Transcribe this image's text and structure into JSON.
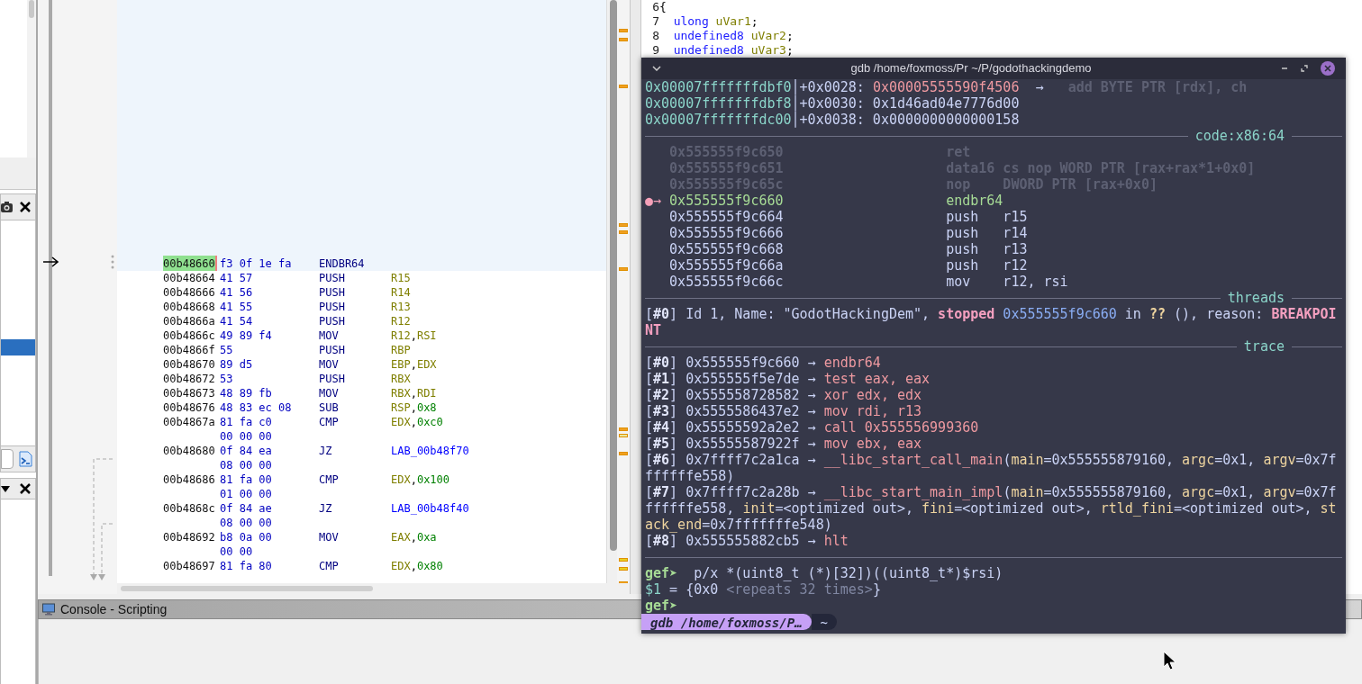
{
  "listing": {
    "rows": [
      {
        "address": "00b48660",
        "bytes": "f3 0f 1e fa",
        "mnemonic": "ENDBR64",
        "operands": [],
        "selected": true
      },
      {
        "address": "00b48664",
        "bytes": "41 57",
        "mnemonic": "PUSH",
        "operands": [
          {
            "text": "R15",
            "kind": "reg"
          }
        ],
        "selected": false
      },
      {
        "address": "00b48666",
        "bytes": "41 56",
        "mnemonic": "PUSH",
        "operands": [
          {
            "text": "R14",
            "kind": "reg"
          }
        ],
        "selected": false
      },
      {
        "address": "00b48668",
        "bytes": "41 55",
        "mnemonic": "PUSH",
        "operands": [
          {
            "text": "R13",
            "kind": "reg"
          }
        ],
        "selected": false
      },
      {
        "address": "00b4866a",
        "bytes": "41 54",
        "mnemonic": "PUSH",
        "operands": [
          {
            "text": "R12",
            "kind": "reg"
          }
        ],
        "selected": false
      },
      {
        "address": "00b4866c",
        "bytes": "49 89 f4",
        "mnemonic": "MOV",
        "operands": [
          {
            "text": "R12",
            "kind": "reg"
          },
          {
            "text": ",",
            "kind": "punct"
          },
          {
            "text": "RSI",
            "kind": "reg"
          }
        ],
        "selected": false
      },
      {
        "address": "00b4866f",
        "bytes": "55",
        "mnemonic": "PUSH",
        "operands": [
          {
            "text": "RBP",
            "kind": "reg"
          }
        ],
        "selected": false
      },
      {
        "address": "00b48670",
        "bytes": "89 d5",
        "mnemonic": "MOV",
        "operands": [
          {
            "text": "EBP",
            "kind": "reg"
          },
          {
            "text": ",",
            "kind": "punct"
          },
          {
            "text": "EDX",
            "kind": "reg"
          }
        ],
        "selected": false
      },
      {
        "address": "00b48672",
        "bytes": "53",
        "mnemonic": "PUSH",
        "operands": [
          {
            "text": "RBX",
            "kind": "reg"
          }
        ],
        "selected": false
      },
      {
        "address": "00b48673",
        "bytes": "48 89 fb",
        "mnemonic": "MOV",
        "operands": [
          {
            "text": "RBX",
            "kind": "reg"
          },
          {
            "text": ",",
            "kind": "punct"
          },
          {
            "text": "RDI",
            "kind": "reg"
          }
        ],
        "selected": false
      },
      {
        "address": "00b48676",
        "bytes": "48 83 ec 08",
        "mnemonic": "SUB",
        "operands": [
          {
            "text": "RSP",
            "kind": "reg"
          },
          {
            "text": ",",
            "kind": "punct"
          },
          {
            "text": "0x8",
            "kind": "num"
          }
        ],
        "selected": false
      },
      {
        "address": "00b4867a",
        "bytes": "81 fa c0",
        "bytes_more": "00 00 00",
        "mnemonic": "CMP",
        "operands": [
          {
            "text": "EDX",
            "kind": "reg"
          },
          {
            "text": ",",
            "kind": "punct"
          },
          {
            "text": "0xc0",
            "kind": "num"
          }
        ],
        "selected": false
      },
      {
        "address": "00b48680",
        "bytes": "0f 84 ea",
        "bytes_more": "08 00 00",
        "mnemonic": "JZ",
        "operands": [
          {
            "text": "LAB_00b48f70",
            "kind": "label"
          }
        ],
        "selected": false
      },
      {
        "address": "00b48686",
        "bytes": "81 fa 00",
        "bytes_more": "01 00 00",
        "mnemonic": "CMP",
        "operands": [
          {
            "text": "EDX",
            "kind": "reg"
          },
          {
            "text": ",",
            "kind": "punct"
          },
          {
            "text": "0x100",
            "kind": "num"
          }
        ],
        "selected": false
      },
      {
        "address": "00b4868c",
        "bytes": "0f 84 ae",
        "bytes_more": "08 00 00",
        "mnemonic": "JZ",
        "operands": [
          {
            "text": "LAB_00b48f40",
            "kind": "label"
          }
        ],
        "selected": false
      },
      {
        "address": "00b48692",
        "bytes": "b8 0a 00",
        "bytes_more": "00 00",
        "mnemonic": "MOV",
        "operands": [
          {
            "text": "EAX",
            "kind": "reg"
          },
          {
            "text": ",",
            "kind": "punct"
          },
          {
            "text": "0xa",
            "kind": "num"
          }
        ],
        "selected": false
      },
      {
        "address": "00b48697",
        "bytes": "81 fa 80",
        "mnemonic": "CMP",
        "operands": [
          {
            "text": "EDX",
            "kind": "reg"
          },
          {
            "text": ",",
            "kind": "punct"
          },
          {
            "text": "0x80",
            "kind": "num"
          }
        ],
        "selected": false
      }
    ]
  },
  "decompiler": {
    "lines": [
      {
        "number": "6",
        "segments": [
          {
            "text": "{",
            "kind": "punct"
          }
        ]
      },
      {
        "number": "7",
        "segments": [
          {
            "text": "ulong",
            "kind": "type"
          },
          {
            "text": "uVar1",
            "kind": "var"
          },
          {
            "text": ";",
            "kind": "punct"
          }
        ]
      },
      {
        "number": "8",
        "segments": [
          {
            "text": "undefined8",
            "kind": "type"
          },
          {
            "text": "uVar2",
            "kind": "var"
          },
          {
            "text": ";",
            "kind": "punct"
          }
        ]
      },
      {
        "number": "9",
        "segments": [
          {
            "text": "undefined8",
            "kind": "type"
          },
          {
            "text": "uVar3",
            "kind": "var"
          },
          {
            "text": ";",
            "kind": "punct"
          }
        ]
      }
    ]
  },
  "console": {
    "title": "Console - Scripting"
  },
  "terminal": {
    "title": "gdb /home/foxmoss/Pr ~/P/godothackingdemo",
    "lines": [
      {
        "kind": "text",
        "segments": [
          {
            "text": "0x00007fffffffdbf0",
            "kind": "addr"
          },
          {
            "text": "│+0x0028: ",
            "kind": "plain"
          },
          {
            "text": "0x00005555590f4506",
            "kind": "pink"
          },
          {
            "text": "  →   ",
            "kind": "plain"
          },
          {
            "text": "add BYTE PTR [rdx], ch",
            "kind": "dim"
          }
        ]
      },
      {
        "kind": "text",
        "segments": [
          {
            "text": "0x00007fffffffdbf8",
            "kind": "addr"
          },
          {
            "text": "│+0x0030: 0x1d46ad04e7776d00",
            "kind": "plain"
          }
        ]
      },
      {
        "kind": "text",
        "segments": [
          {
            "text": "0x00007fffffffdc00",
            "kind": "addr"
          },
          {
            "text": "│+0x0038: 0x0000000000000158",
            "kind": "plain"
          }
        ]
      },
      {
        "kind": "rule",
        "title": "code:x86:64"
      },
      {
        "kind": "text",
        "segments": [
          {
            "text": "   0x555555f9c650                    ret",
            "kind": "dim"
          }
        ]
      },
      {
        "kind": "text",
        "segments": [
          {
            "text": "   0x555555f9c651                    data16 cs nop WORD PTR [rax+rax*1+0x0]",
            "kind": "dim"
          }
        ]
      },
      {
        "kind": "text",
        "segments": [
          {
            "text": "   0x555555f9c65c                    nop    DWORD PTR [rax+0x0]",
            "kind": "dim"
          }
        ]
      },
      {
        "kind": "text",
        "segments": [
          {
            "text": "●→ ",
            "kind": "marker"
          },
          {
            "text": "0x555555f9c660                    endbr64",
            "kind": "green"
          }
        ]
      },
      {
        "kind": "text",
        "segments": [
          {
            "text": "   0x555555f9c664                    push   r15",
            "kind": "plain"
          }
        ]
      },
      {
        "kind": "text",
        "segments": [
          {
            "text": "   0x555555f9c666                    push   r14",
            "kind": "plain"
          }
        ]
      },
      {
        "kind": "text",
        "segments": [
          {
            "text": "   0x555555f9c668                    push   r13",
            "kind": "plain"
          }
        ]
      },
      {
        "kind": "text",
        "segments": [
          {
            "text": "   0x555555f9c66a                    push   r12",
            "kind": "plain"
          }
        ]
      },
      {
        "kind": "text",
        "segments": [
          {
            "text": "   0x555555f9c66c                    mov    r12, rsi",
            "kind": "plain"
          }
        ]
      },
      {
        "kind": "rule",
        "title": "threads"
      },
      {
        "kind": "text",
        "segments": [
          {
            "text": "[",
            "kind": "plain"
          },
          {
            "text": "#0",
            "kind": "bold"
          },
          {
            "text": "] Id 1, Name: \"GodotHackingDem\", ",
            "kind": "plain"
          },
          {
            "text": "stopped",
            "kind": "alert"
          },
          {
            "text": " 0x555555f9c660",
            "kind": "blue"
          },
          {
            "text": " in ",
            "kind": "plain"
          },
          {
            "text": "??",
            "kind": "yellowbold"
          },
          {
            "text": " (), reason: ",
            "kind": "plain"
          },
          {
            "text": "BREAKPOINT",
            "kind": "alert"
          }
        ]
      },
      {
        "kind": "rule",
        "title": "trace"
      },
      {
        "kind": "text",
        "segments": [
          {
            "text": "[",
            "kind": "plain"
          },
          {
            "text": "#0",
            "kind": "bold"
          },
          {
            "text": "] 0x555555f9c660 → ",
            "kind": "plain"
          },
          {
            "text": "endbr64",
            "kind": "pink"
          }
        ]
      },
      {
        "kind": "text",
        "segments": [
          {
            "text": "[",
            "kind": "plain"
          },
          {
            "text": "#1",
            "kind": "bold"
          },
          {
            "text": "] 0x555555f5e7de → ",
            "kind": "plain"
          },
          {
            "text": "test eax, eax",
            "kind": "pink"
          }
        ]
      },
      {
        "kind": "text",
        "segments": [
          {
            "text": "[",
            "kind": "plain"
          },
          {
            "text": "#2",
            "kind": "bold"
          },
          {
            "text": "] 0x555558728582 → ",
            "kind": "plain"
          },
          {
            "text": "xor edx, edx",
            "kind": "pink"
          }
        ]
      },
      {
        "kind": "text",
        "segments": [
          {
            "text": "[",
            "kind": "plain"
          },
          {
            "text": "#3",
            "kind": "bold"
          },
          {
            "text": "] 0x5555586437e2 → ",
            "kind": "plain"
          },
          {
            "text": "mov rdi, r13",
            "kind": "pink"
          }
        ]
      },
      {
        "kind": "text",
        "segments": [
          {
            "text": "[",
            "kind": "plain"
          },
          {
            "text": "#4",
            "kind": "bold"
          },
          {
            "text": "] 0x55555592a2e2 → ",
            "kind": "plain"
          },
          {
            "text": "call 0x555556999360",
            "kind": "pink"
          }
        ]
      },
      {
        "kind": "text",
        "segments": [
          {
            "text": "[",
            "kind": "plain"
          },
          {
            "text": "#5",
            "kind": "bold"
          },
          {
            "text": "] 0x55555587922f → ",
            "kind": "plain"
          },
          {
            "text": "mov ebx, eax",
            "kind": "pink"
          }
        ]
      },
      {
        "kind": "text",
        "segments": [
          {
            "text": "[",
            "kind": "plain"
          },
          {
            "text": "#6",
            "kind": "bold"
          },
          {
            "text": "] 0x7ffff7c2a1ca → ",
            "kind": "plain"
          },
          {
            "text": "__libc_start_call_main",
            "kind": "pink"
          },
          {
            "text": "(",
            "kind": "plain"
          },
          {
            "text": "main",
            "kind": "yellow"
          },
          {
            "text": "=0x555555879160, ",
            "kind": "plain"
          },
          {
            "text": "argc",
            "kind": "yellow"
          },
          {
            "text": "=0x1, ",
            "kind": "plain"
          },
          {
            "text": "argv",
            "kind": "yellow"
          },
          {
            "text": "=0x7fffffffe558)",
            "kind": "plain"
          }
        ]
      },
      {
        "kind": "text",
        "segments": [
          {
            "text": "[",
            "kind": "plain"
          },
          {
            "text": "#7",
            "kind": "bold"
          },
          {
            "text": "] 0x7ffff7c2a28b → ",
            "kind": "plain"
          },
          {
            "text": "__libc_start_main_impl",
            "kind": "pink"
          },
          {
            "text": "(",
            "kind": "plain"
          },
          {
            "text": "main",
            "kind": "yellow"
          },
          {
            "text": "=0x555555879160, ",
            "kind": "plain"
          },
          {
            "text": "argc",
            "kind": "yellow"
          },
          {
            "text": "=0x1, ",
            "kind": "plain"
          },
          {
            "text": "argv",
            "kind": "yellow"
          },
          {
            "text": "=0x7fffffffe558, ",
            "kind": "plain"
          },
          {
            "text": "init",
            "kind": "yellow"
          },
          {
            "text": "=<optimized out>, ",
            "kind": "plain"
          },
          {
            "text": "fini",
            "kind": "yellow"
          },
          {
            "text": "=<optimized out>, ",
            "kind": "plain"
          },
          {
            "text": "rtld_fini",
            "kind": "yellow"
          },
          {
            "text": "=<optimized out>, ",
            "kind": "plain"
          },
          {
            "text": "stack_end",
            "kind": "yellow"
          },
          {
            "text": "=0x7fffffffe548)",
            "kind": "plain"
          }
        ]
      },
      {
        "kind": "text",
        "segments": [
          {
            "text": "[",
            "kind": "plain"
          },
          {
            "text": "#8",
            "kind": "bold"
          },
          {
            "text": "] 0x555555882cb5 → ",
            "kind": "plain"
          },
          {
            "text": "hlt",
            "kind": "pink"
          }
        ]
      },
      {
        "kind": "rule"
      },
      {
        "kind": "text",
        "segments": [
          {
            "text": "gef➤ ",
            "kind": "prompt"
          },
          {
            "text": " p/x *(uint8_t (*)[32])((uint8_t*)$rsi)",
            "kind": "plain"
          }
        ]
      },
      {
        "kind": "text",
        "segments": [
          {
            "text": "$1",
            "kind": "addr"
          },
          {
            "text": " = {0x0 ",
            "kind": "plain"
          },
          {
            "text": "<repeats 32 times>",
            "kind": "gray"
          },
          {
            "text": "}",
            "kind": "plain"
          }
        ]
      },
      {
        "kind": "text",
        "segments": [
          {
            "text": "gef➤",
            "kind": "prompt"
          }
        ]
      }
    ],
    "tabs": [
      {
        "label": "gdb /home/foxmoss/P…",
        "selected": true
      },
      {
        "label": "~",
        "selected": false
      }
    ]
  }
}
